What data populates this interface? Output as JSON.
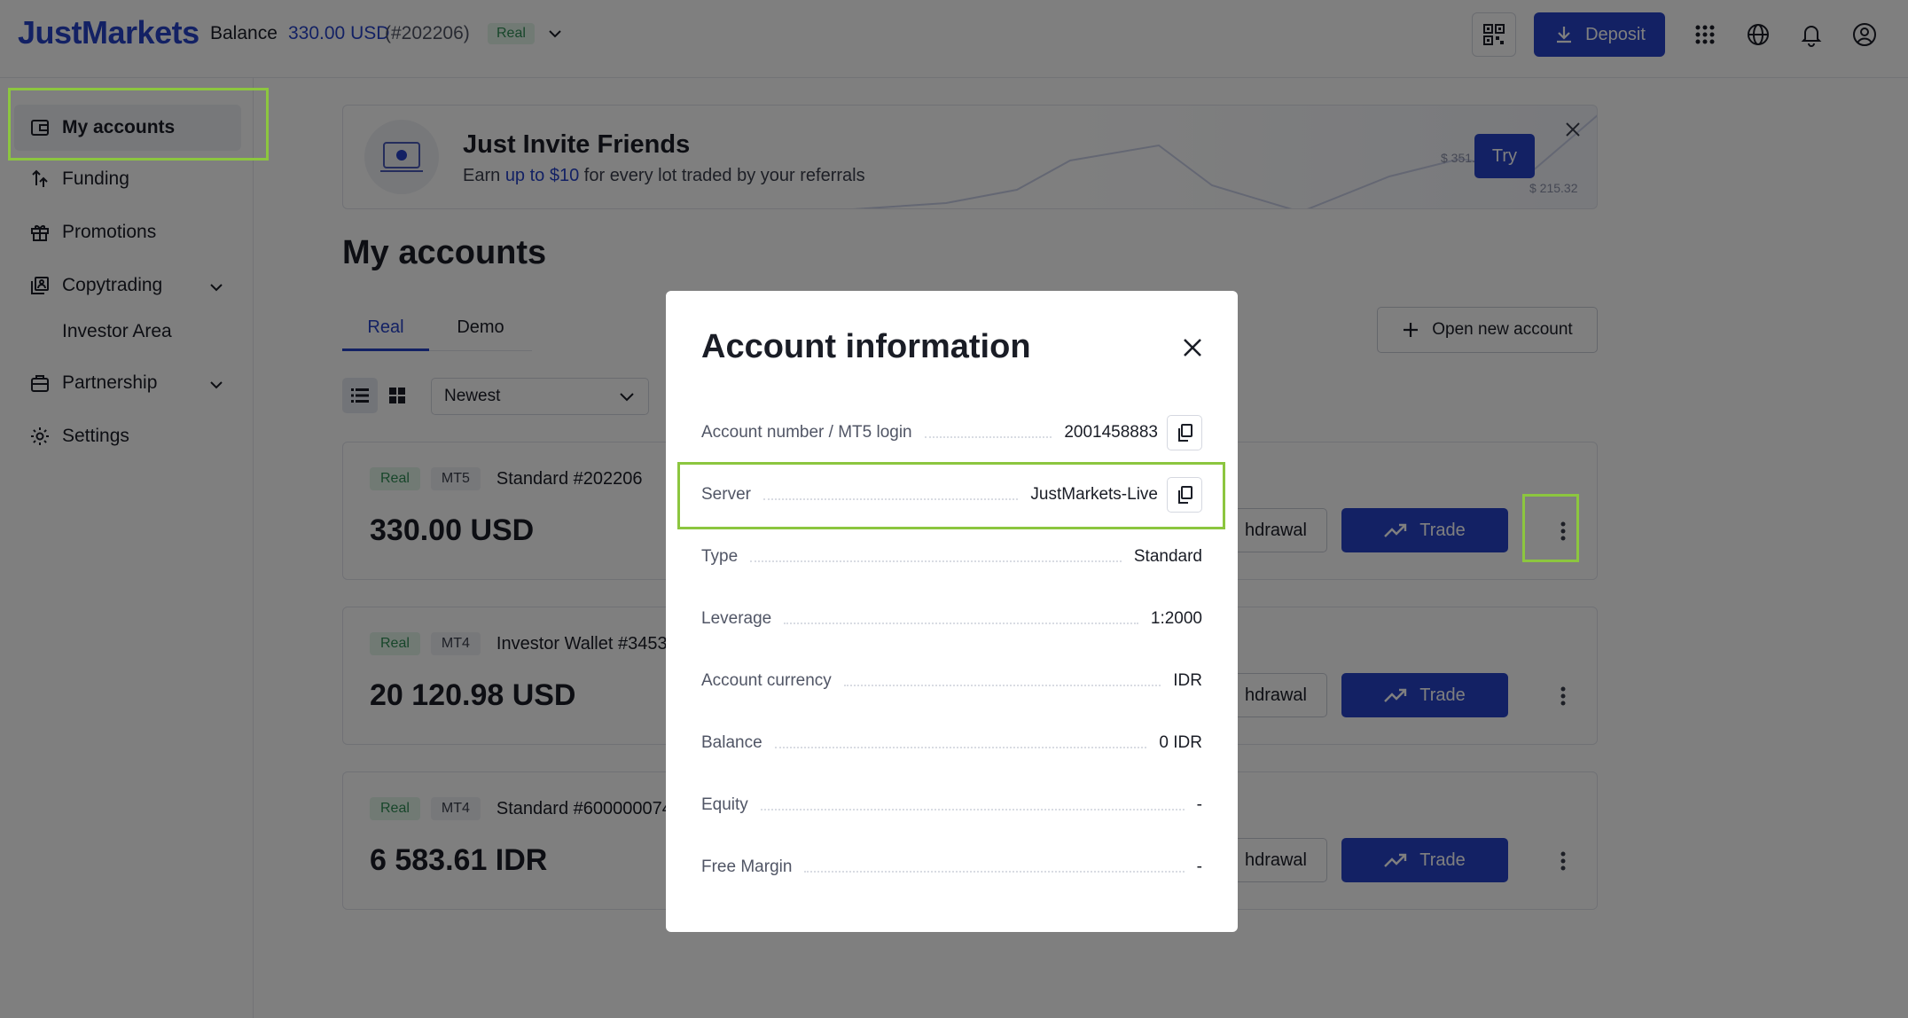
{
  "header": {
    "logo": "JustMarkets",
    "balance_label": "Balance",
    "balance_amount": "330.00 USD",
    "account_id": "(#202206)",
    "account_type": "Real",
    "deposit_label": "Deposit"
  },
  "sidebar": {
    "items": [
      {
        "label": "My accounts"
      },
      {
        "label": "Funding"
      },
      {
        "label": "Promotions"
      },
      {
        "label": "Copytrading"
      },
      {
        "label": "Investor Area"
      },
      {
        "label": "Partnership"
      },
      {
        "label": "Settings"
      }
    ]
  },
  "banner": {
    "title": "Just Invite Friends",
    "sub_prefix": "Earn ",
    "sub_link": "up to $10",
    "sub_suffix": " for every lot traded by your referrals",
    "price1": "$  351.32",
    "price2": "$  215.32",
    "try_label": "Try"
  },
  "main": {
    "title": "My accounts",
    "tabs": [
      {
        "label": "Real"
      },
      {
        "label": "Demo"
      }
    ],
    "open_account_label": "Open new account",
    "sort_value": "Newest",
    "withdrawal_label": "hdrawal",
    "trade_label": "Trade",
    "accounts": [
      {
        "type": "Real",
        "platform": "MT5",
        "name": "Standard #202206",
        "amount": "330.00 USD"
      },
      {
        "type": "Real",
        "platform": "MT4",
        "name": "Investor Wallet #3453",
        "amount": "20 120.98 USD"
      },
      {
        "type": "Real",
        "platform": "MT4",
        "name": "Standard #600000074",
        "amount": "6 583.61 IDR"
      }
    ]
  },
  "modal": {
    "title": "Account information",
    "rows": [
      {
        "label": "Account number / MT5 login",
        "value": "2001458883"
      },
      {
        "label": "Server",
        "value": "JustMarkets-Live"
      },
      {
        "label": "Type",
        "value": "Standard"
      },
      {
        "label": "Leverage",
        "value": "1:2000"
      },
      {
        "label": "Account currency",
        "value": "IDR"
      },
      {
        "label": "Balance",
        "value": "0 IDR"
      },
      {
        "label": "Equity",
        "value": "-"
      },
      {
        "label": "Free Margin",
        "value": "-"
      }
    ]
  },
  "colors": {
    "brand": "#2743c9",
    "highlight": "#8cc63f",
    "real_badge": "#2f8c55"
  }
}
